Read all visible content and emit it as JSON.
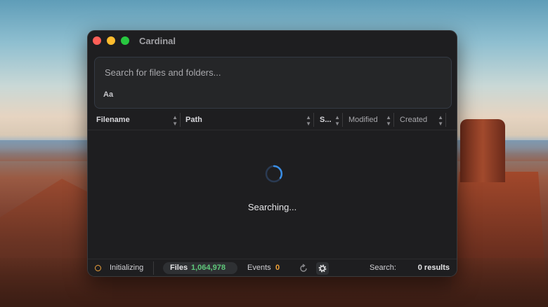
{
  "window": {
    "title": "Cardinal"
  },
  "search": {
    "placeholder": "Search for files and folders...",
    "value": "",
    "case_toggle": "Aa"
  },
  "columns": [
    {
      "label": "Filename"
    },
    {
      "label": "Path"
    },
    {
      "label": "S..."
    },
    {
      "label": "Modified"
    },
    {
      "label": "Created"
    }
  ],
  "main": {
    "status": "Searching..."
  },
  "statusbar": {
    "state": "Initializing",
    "files_label": "Files",
    "files_count": "1,064,978",
    "events_label": "Events",
    "events_count": "0",
    "search_label": "Search:",
    "results": "0 results"
  },
  "colors": {
    "accent": "#3a8ee6",
    "files_count": "#5fc77a",
    "status_warning": "#f0a23a"
  },
  "icons": [
    "close-icon",
    "minimize-icon",
    "maximize-icon",
    "sort-icon",
    "spinner-icon",
    "status-dot-icon",
    "refresh-icon",
    "gear-icon"
  ]
}
